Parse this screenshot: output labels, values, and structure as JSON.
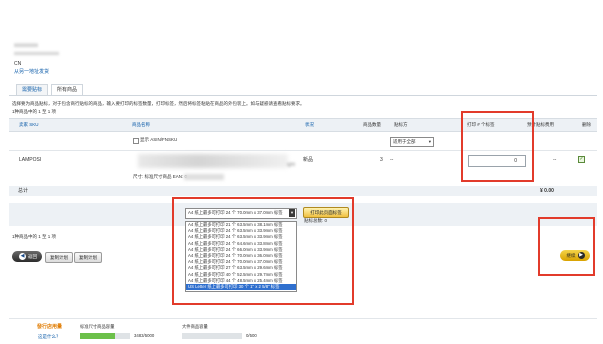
{
  "header": {
    "blurred_line_1": "xxxxxxxx",
    "blurred_line_2": "xxxxxxxxxxxxxxxxxx",
    "country": "CN",
    "back_link": "从另一地址发货"
  },
  "tabs": [
    {
      "label": "需要贴标"
    },
    {
      "label": "所有商品"
    }
  ],
  "instructions": "选择要为商品贴标，对于包含商行贴标的商品，输入要打印的标签数量，打印标签，然后将标签粘贴在商品的外包装上。如与疑惑请查看贴标要求。",
  "showing_top": "1种商品中的 1 至 1 项",
  "table": {
    "headers": {
      "sku": "卖家 SKU",
      "product_name": "商品名称",
      "condition": "状况",
      "quantity": "商品数量",
      "labeled_by": "贴标方",
      "print_count": "打印 # 个标签",
      "est_fee": "预计贴标费用",
      "delete": "删除"
    },
    "filter_checkbox_label": "显示 ASIN/FNSKU",
    "labeled_by_select": "适用于全部",
    "row": {
      "sku": "LAMPOSI",
      "name_tail": "ight",
      "size_note": "尺寸: 标准尺寸商品 EAN: 0",
      "condition": "新品",
      "quantity": "3",
      "labeled_by": "--",
      "print_count": "0",
      "est_fee": "--"
    },
    "total_label": "总计",
    "total_value": "¥ 0.00"
  },
  "label_popup": {
    "selected": "A4 纸上最多可打印 24 个 70.0mm x 37.0mm 标签",
    "print_button": "打印此页面标签",
    "count_label": "贴标总数: 0",
    "options": [
      "A4 纸上最多可打印 21 个 63.5mm x 38.1mm 标签",
      "A4 纸上最多可打印 24 个 63.5mm x 33.9mm 标签",
      "A4 纸上最多可打印 24 个 63.5mm x 33.9mm 标签",
      "A4 纸上最多可打印 24 个 64.6mm x 33.8mm 标签",
      "A4 纸上最多可打印 24 个 66.0mm x 33.9mm 标签",
      "A4 纸上最多可打印 24 个 70.0mm x 36.0mm 标签",
      "A4 纸上最多可打印 24 个 70.0mm x 37.0mm 标签",
      "A4 纸上最多可打印 27 个 63.5mm x 29.6mm 标签",
      "A4 纸上最多可打印 40 个 52.5mm x 29.7mm 标签",
      "A4 纸上最多可打印 44 个 48.5mm x 25.4mm 标签",
      "US Letter 纸上最多可打印 30 个 1\" x 2 5/8\" 标签"
    ]
  },
  "showing_bottom": "1种商品中的 1 至 1 项",
  "footer_buttons": {
    "back": "返回",
    "duplicate": "复制计划",
    "copy": "复制计划",
    "continue": "继续"
  },
  "capacity": {
    "title": "發行店用量",
    "help": "这是什么？",
    "standard_label": "标准尺寸商品容量",
    "standard_value": "3483/5000",
    "standard_fraction": 0.6966,
    "oversize_label": "大件商品容量",
    "oversize_value": "0/500",
    "oversize_fraction": 0
  },
  "colors": {
    "highlight": "#e23b2b",
    "link": "#0a5aa8",
    "capacity_green": "#6cc04a",
    "capacity_title": "#e07b00"
  }
}
